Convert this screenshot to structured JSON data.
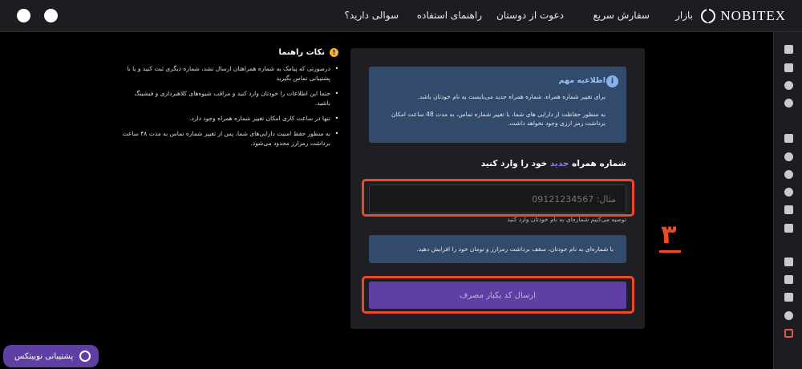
{
  "header": {
    "logo": "NOBITEX",
    "nav": [
      "بازار",
      "سفارش سریع",
      "دعوت از دوستان",
      "راهنمای استفاده",
      "سوالی دارید؟"
    ]
  },
  "notice": {
    "title": "اطلاعیه مهم",
    "icon": "i",
    "line1": "برای تغییر شماره همراه، شماره همراه جدید می‌بایست به نام خودتان باشد.",
    "line2": "به منظور حفاظت از دارایی های شما، با تغییر شماره تماس، به مدت 48 ساعت امکان برداشت رمز ارزی وجود نخواهد داشت."
  },
  "phone": {
    "title_before": "شماره همراه",
    "title_highlight": "جدید",
    "title_after": "خود را وارد کنید",
    "placeholder": "مثال: 09121234567",
    "hint": "توصیه می‌کنیم شماره‌ای به نام خودتان وارد کنید"
  },
  "info_box": "با شماره‌ای به نام خودتان، سقف برداشت رمزارز و تومان خود را افزایش دهید.",
  "send_button": "ارسال کد یکبار مصرف",
  "step_number": "۳",
  "tips": {
    "title": "نکات راهنما",
    "icon": "!",
    "items": [
      "درصورتی که پیامک به شماره همراهتان ارسال نشد، شماره دیگری ثبت کنید و یا با پشتیبانی تماس بگیرید",
      "حتما این اطلاعات را خودتان وارد کنید و مراقب شیوه‌های کلاهبرداری و فیشینگ باشید.",
      "تنها در ساعت کاری امکان تغییر شماره همراه وجود دارد.",
      "به منظور حفظ امنیت دارایی‌های شما، پس از تغییر شماره تماس به مدت ۴۸ ساعت برداشت رمزارز محدود می‌شود."
    ]
  },
  "support": "پشتیبانی نوبیتکس",
  "colors": {
    "accent": "#5f3fa4",
    "highlight": "#ec4b25",
    "notice_bg": "#324a6b"
  }
}
